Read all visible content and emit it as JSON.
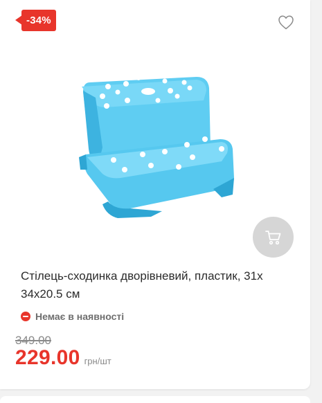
{
  "product": {
    "discount_badge": "-34%",
    "title": "Стілець-сходинка дворівневий, пластик, 31х 34х20.5 см",
    "stock_status": "Немає в наявності",
    "old_price": "349.00",
    "new_price": "229.00",
    "price_unit": "грн/шт"
  },
  "icons": {
    "wishlist": "heart-outline-icon",
    "cart": "cart-icon",
    "stock": "minus-circle-icon"
  },
  "colors": {
    "accent": "#e8352b",
    "product_blue": "#4cc4ec",
    "cart_button_bg": "#d6d6d6"
  }
}
